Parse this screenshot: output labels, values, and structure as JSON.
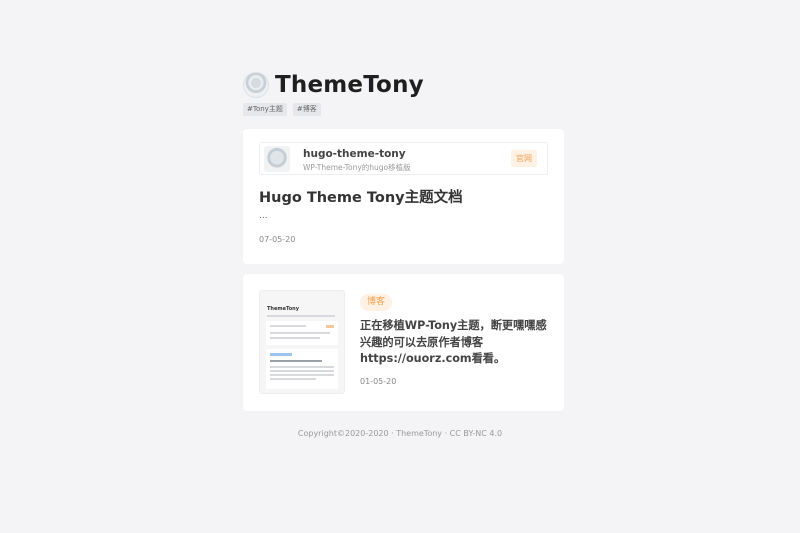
{
  "site": {
    "title": "ThemeTony",
    "tags": [
      "#Tony主题",
      "#博客"
    ]
  },
  "card1": {
    "repo": {
      "name": "hugo-theme-tony",
      "description": "WP-Theme-Tony的hugo移植版",
      "button_label": "官网"
    },
    "post_title": "Hugo Theme Tony主题文档",
    "excerpt": "...",
    "date": "07-05-20"
  },
  "card2": {
    "badge": "博客",
    "text": "正在移植WP-Tony主题，断更嘿嘿感兴趣的可以去原作者博客https://ouorz.com看看。",
    "date": "01-05-20",
    "thumbnail": {
      "title": "ThemeTony"
    }
  },
  "footer": {
    "copyright": "Copyright©2020-2020 · ThemeTony · ",
    "license": "CC BY-NC 4.0"
  },
  "colors": {
    "background": "#f4f4f6",
    "accent": "#f0a050",
    "accent_bg": "#fff1e4"
  }
}
